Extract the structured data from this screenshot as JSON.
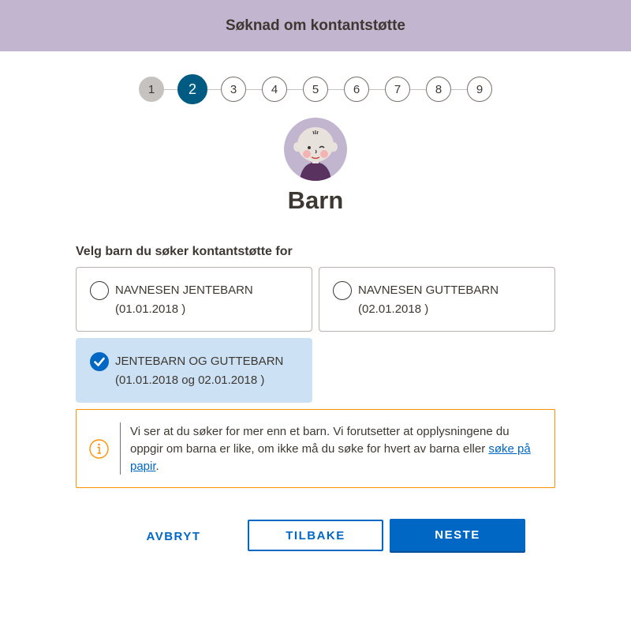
{
  "header": {
    "title": "Søknad om kontantstøtte"
  },
  "stepper": {
    "current": 2,
    "steps": [
      "1",
      "2",
      "3",
      "4",
      "5",
      "6",
      "7",
      "8",
      "9"
    ]
  },
  "page": {
    "title": "Barn"
  },
  "form": {
    "legend": "Velg barn du søker kontantstøtte for",
    "options": [
      {
        "name": "NAVNESEN JENTEBARN",
        "date": "(01.01.2018 )",
        "checked": false
      },
      {
        "name": "NAVNESEN GUTTEBARN",
        "date": "(02.01.2018 )",
        "checked": false
      },
      {
        "name": "JENTEBARN OG GUTTEBARN",
        "date": "(01.01.2018 og 02.01.2018 )",
        "checked": true
      }
    ]
  },
  "alert": {
    "text": "Vi ser at du søker for mer enn et barn. Vi forutsetter at opplysningene du oppgir om barna er like, om ikke må du søke for hvert av barna eller ",
    "link_text": "søke på papir",
    "text_end": "."
  },
  "buttons": {
    "cancel": "AVBRYT",
    "back": "TILBAKE",
    "next": "NESTE"
  },
  "colors": {
    "header_bg": "#c1b5d0",
    "active_step": "#005b82",
    "primary": "#0067c5",
    "checked_bg": "#cce1f3",
    "warning": "#ff9100"
  },
  "icons": {
    "avatar": "baby-avatar-icon",
    "check": "checkmark-icon",
    "info": "info-icon"
  }
}
